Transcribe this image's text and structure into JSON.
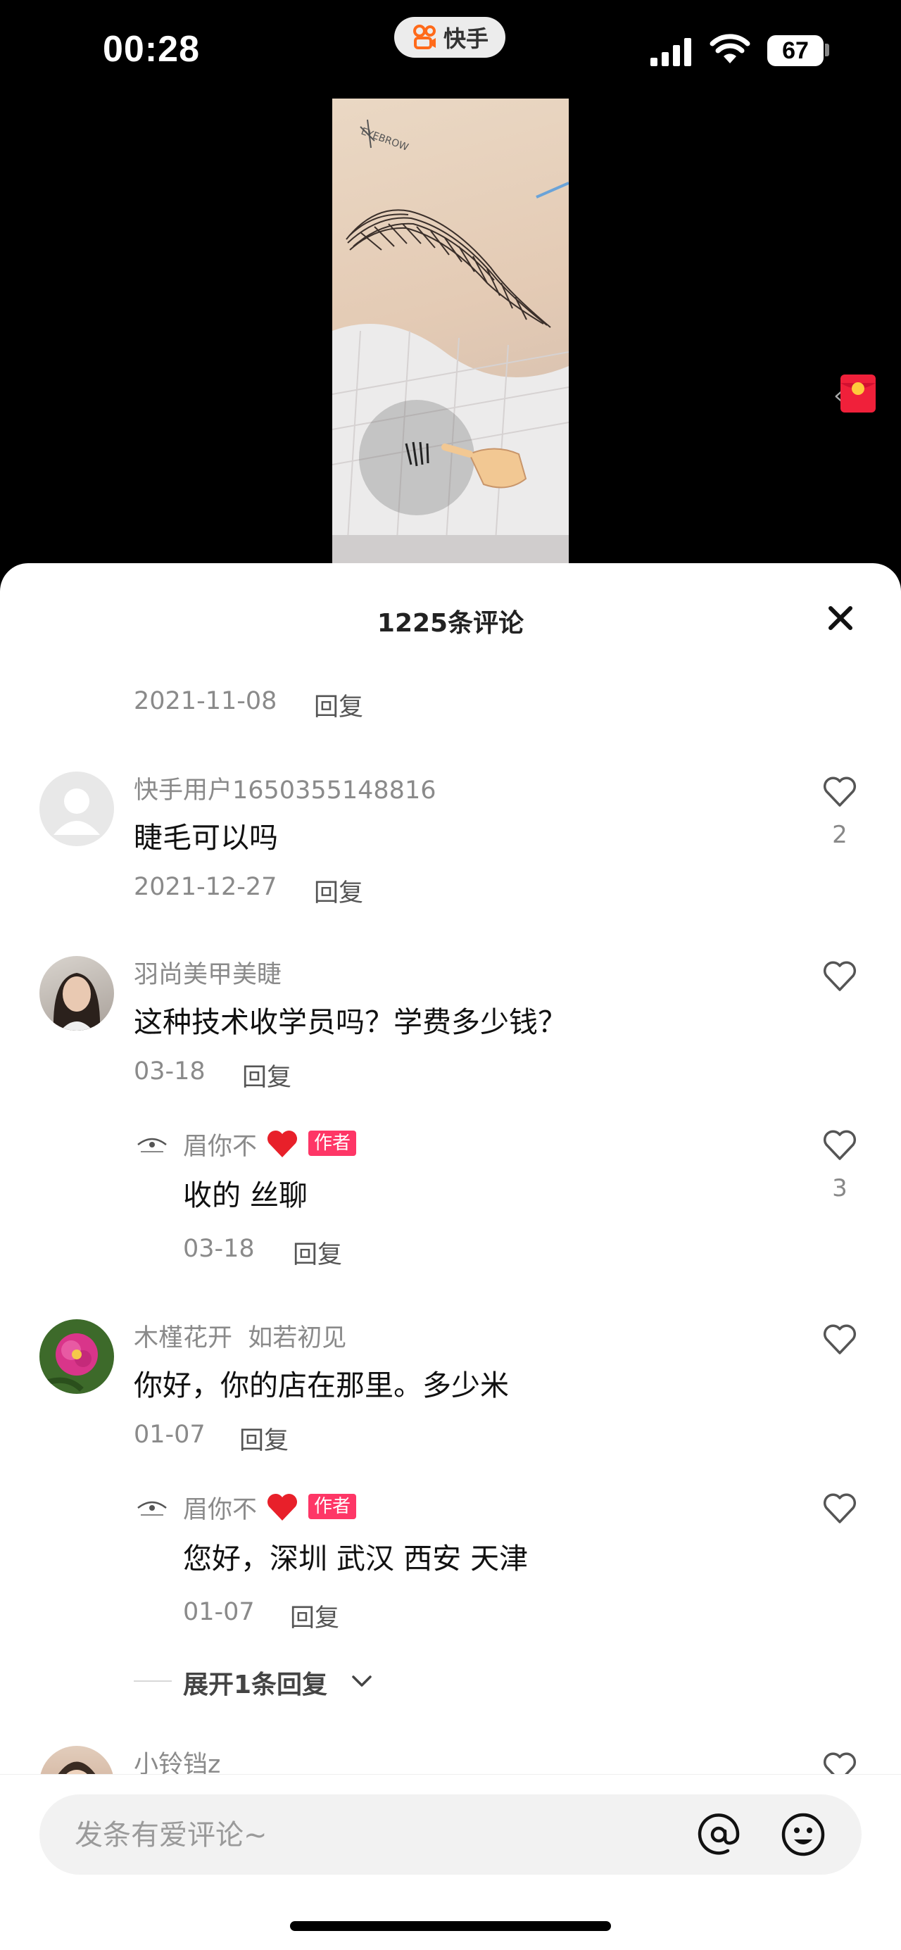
{
  "status_bar": {
    "time": "00:28",
    "app_name": "快手",
    "battery": "67"
  },
  "sheet": {
    "title": "1225条评论"
  },
  "comments": [
    {
      "date": "2021-11-08",
      "reply_label": "回复"
    },
    {
      "user": "快手用户1650355148816",
      "text": "睫毛可以吗",
      "date": "2021-12-27",
      "reply_label": "回复",
      "likes": "2"
    },
    {
      "user": "羽尚美甲美睫",
      "text": "这种技术收学员吗？学费多少钱？",
      "date": "03-18",
      "reply_label": "回复",
      "reply": {
        "user": "眉你不",
        "badge": "作者",
        "text": "收的 丝聊",
        "date": "03-18",
        "reply_label": "回复",
        "likes": "3"
      }
    },
    {
      "user": "木槿花开  如若初见",
      "text": "你好，你的店在那里。多少米",
      "date": "01-07",
      "reply_label": "回复",
      "reply": {
        "user": "眉你不",
        "badge": "作者",
        "text": "您好，深圳 武汉 西安 天津",
        "date": "01-07",
        "reply_label": "回复"
      },
      "expand_label": "展开1条回复"
    },
    {
      "user": "小铃铛z"
    }
  ],
  "input": {
    "placeholder": "发条有爱评论~"
  },
  "colors": {
    "accent": "#fe3666",
    "brand": "#ff6a1a"
  },
  "icons": [
    "close-icon",
    "heart-icon",
    "at-icon",
    "emoji-icon",
    "red-packet-icon",
    "chevron-down-icon"
  ]
}
